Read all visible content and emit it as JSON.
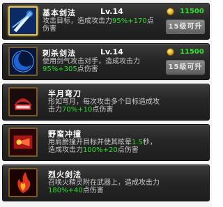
{
  "skills": [
    {
      "name": "基本剑法",
      "level": "Lv.14",
      "desc_prefix": "攻击目标，造成攻击力",
      "desc_value": "95%+170",
      "desc_suffix": "点伤害",
      "cost": "11500",
      "button": "15级可升",
      "icon": "sword-slash-icon"
    },
    {
      "name": "刺杀剑法",
      "level": "Lv.14",
      "desc_prefix": "使用剑气攻击对手，造成攻击力",
      "desc_value": "95%+305",
      "desc_suffix": "点伤害",
      "cost": "11500",
      "button": "15级可升",
      "icon": "blue-crescent-icon"
    },
    {
      "name": "半月弯刀",
      "desc_prefix": "形如弯月，每次攻击多个目标造成攻击力",
      "desc_value": "70%+10",
      "desc_suffix": "点伤害",
      "icon": "half-moon-blade-icon"
    },
    {
      "name": "野蛮冲撞",
      "desc_prefix": "用肩膀撞开目标并使其眩晕",
      "desc_value_a": "1.5",
      "desc_mid": "秒，造成攻击力",
      "desc_value": "100%+20",
      "desc_suffix": "点伤害",
      "icon": "barbaric-charge-icon"
    },
    {
      "name": "烈火剑法",
      "desc_prefix": "召唤火精灵附在武器上，造成攻击力",
      "desc_value": "180%+40",
      "desc_suffix": "点伤害",
      "icon": "fire-sword-icon"
    }
  ],
  "colors": {
    "highlight": "#2fe02f",
    "desc": "#c9c9c9",
    "name": "#ffffff",
    "frame_selected": "#e8c24a"
  }
}
